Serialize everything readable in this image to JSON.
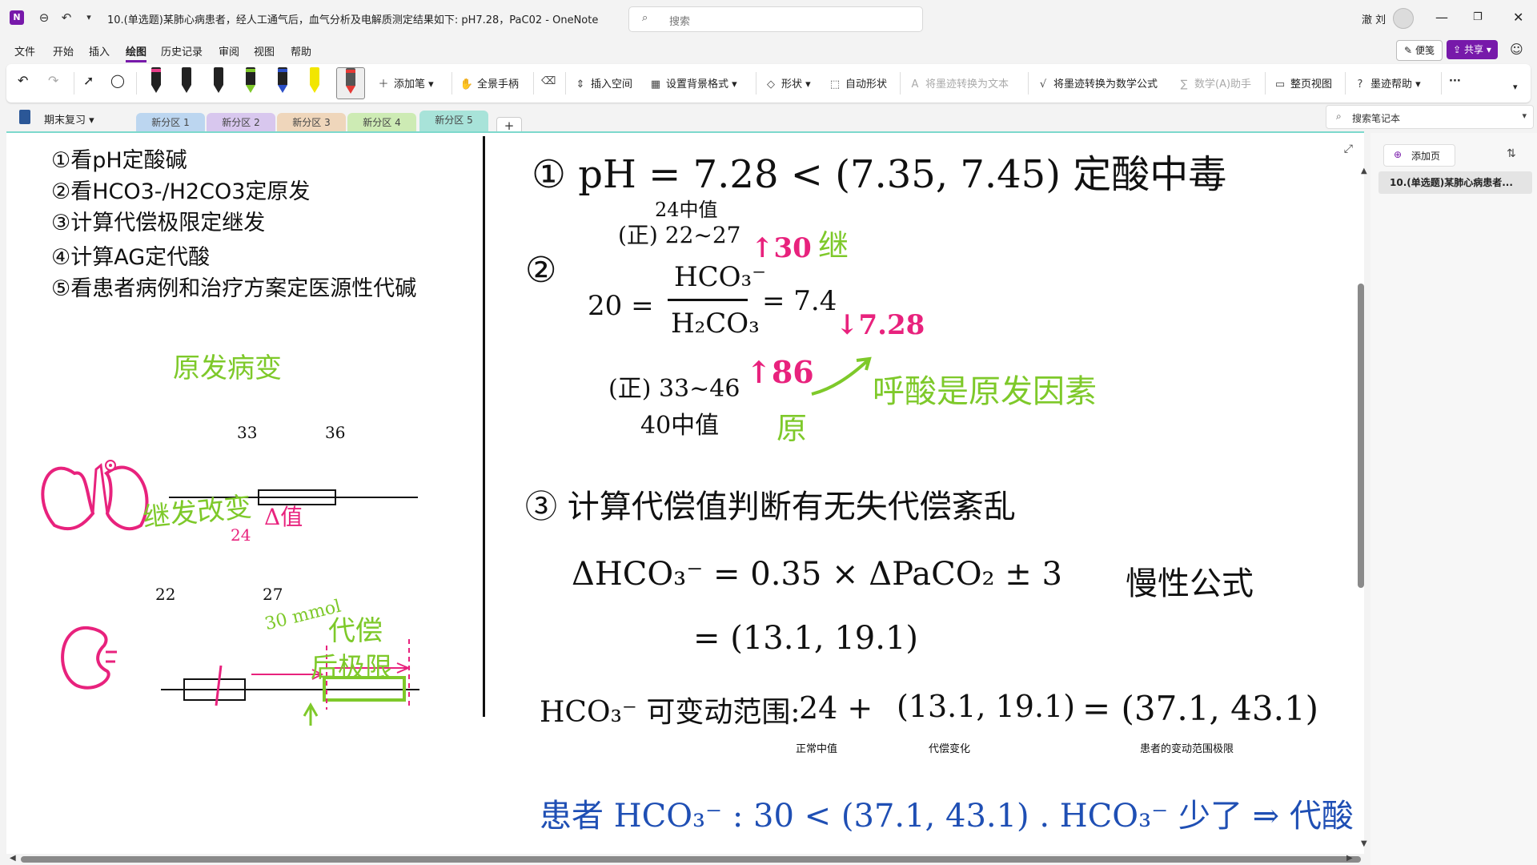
{
  "window": {
    "title": "10.(单选题)某肺心病患者，经人工通气后，血气分析及电解质测定结果如下: pH7.28，PaC02 - OneNote",
    "search_placeholder": "搜索",
    "user_name": "澈 刘"
  },
  "menu": [
    "文件",
    "开始",
    "插入",
    "绘图",
    "历史记录",
    "审阅",
    "视图",
    "帮助"
  ],
  "menu_active": "绘图",
  "top_right": {
    "note_button": "便笺",
    "share_button": "共享"
  },
  "ribbon": {
    "add_pen": "添加笔",
    "hand_tool": "全景手柄",
    "insert_space": "插入空间",
    "background_format": "设置背景格式",
    "shapes": "形状",
    "auto_shape": "自动形状",
    "ink_to_text": "将墨迹转换为文本",
    "ink_to_math": "将墨迹转换为数学公式",
    "math_assistant": "数学(A)助手",
    "page_view": "整页视图",
    "ink_help": "墨迹帮助",
    "pen_colors": [
      "#e83f8a",
      "#222222",
      "#222222",
      "#7ec92a",
      "#2b4fc7",
      "#f2e600",
      "#e53935"
    ]
  },
  "notebook": {
    "name": "期末复习",
    "sections": [
      {
        "label": "新分区 1",
        "color": "#bcd6f0"
      },
      {
        "label": "新分区 2",
        "color": "#d8c7ee"
      },
      {
        "label": "新分区 3",
        "color": "#efd6bb"
      },
      {
        "label": "新分区 4",
        "color": "#cdebb4"
      },
      {
        "label": "新分区 5",
        "color": "#a8e3d9"
      }
    ],
    "active_section": "新分区 5",
    "search_label": "搜索笔记本"
  },
  "pages_panel": {
    "add_page": "添加页",
    "pages": [
      "10.(单选题)某肺心病患者..."
    ]
  },
  "note": {
    "steps": [
      "①看pH定酸碱",
      "②看HCO3-/H2CO3定原发",
      "③计算代偿极限定继发",
      "④计算AG定代酸",
      "⑤看患者病例和治疗方案定医源性代碱"
    ],
    "ink": {
      "primary_change": "原发病变",
      "line1_a": "33",
      "line1_b": "36",
      "secondary_change": "继发改变",
      "delta": "Δ值",
      "line2_mark": "24",
      "line2_a": "22",
      "line2_b": "27",
      "arrow_val": "30 mmol",
      "comp_limit_1": "代偿",
      "comp_limit_2": "后极限",
      "eq1": "① pH = 7.28 < (7.35, 7.45)  定酸中毒",
      "normal_hco3_median": "24中值",
      "normal_hco3": "(正) 22~27",
      "ratio_left": "20 =",
      "ratio_num": "HCO₃⁻",
      "ratio_den": "H₂CO₃",
      "ratio_right": "= 7.4",
      "up30": "↑30",
      "secondary_tag": "继",
      "down728": "↓7.28",
      "normal_paco2": "(正) 33~46",
      "paco2_median": "40中值",
      "up86": "↑86",
      "primary_tag": "原",
      "conclusion1": "呼酸是原发因素",
      "step3": "③ 计算代偿值判断有无失代偿紊乱",
      "formula1": "ΔHCO₃⁻ = 0.35 × ΔPaCO₂ ± 3",
      "formula_note": "慢性公式",
      "formula2": "= (13.1, 19.1)",
      "range_label": "HCO₃⁻ 可变动范围:",
      "range_expr_a": "24 +",
      "range_expr_b": "(13.1, 19.1)",
      "range_expr_c": "= (37.1, 43.1)",
      "caption1": "正常中值",
      "caption2": "代偿变化",
      "caption3": "患者的变动范围极限",
      "patient_line": "患者 HCO₃⁻ : 30 < (37.1, 43.1) . HCO₃⁻ 少了 ⇒ 代酸"
    }
  }
}
